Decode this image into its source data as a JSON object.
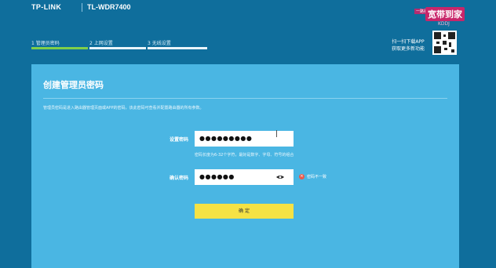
{
  "header": {
    "brand": "TP-LINK",
    "model": "TL-WDR7400"
  },
  "steps": [
    {
      "label": "1 管理员密码",
      "active": true
    },
    {
      "label": "2 上网设置",
      "active": false
    },
    {
      "label": "3 无线设置",
      "active": false
    }
  ],
  "qr": {
    "line1": "扫一扫下载APP",
    "line2": "获取更多新功能"
  },
  "watermark": {
    "tag": "一路看",
    "main": "宽带到家",
    "sub": "KDDJ"
  },
  "panel": {
    "title": "创建管理员密码",
    "description": "管理员密码是进入路由器管理页面或APP的密码，该此密码可查看并配置路由器的所有参数。",
    "password_label": "设置密码",
    "password_value": "●●●●●●●●●",
    "password_hint": "密码长度为6-32个字符，最好是数字、字母、符号的组合",
    "confirm_label": "确认密码",
    "confirm_value": "●●●●●●",
    "error_text": "密码不一致",
    "confirm_button": "确 定"
  },
  "colors": {
    "background": "#0f6e9c",
    "panel": "#4ab6e3",
    "active_step": "#7fcf4a",
    "button": "#f5e245",
    "error": "#ea5a4c"
  }
}
